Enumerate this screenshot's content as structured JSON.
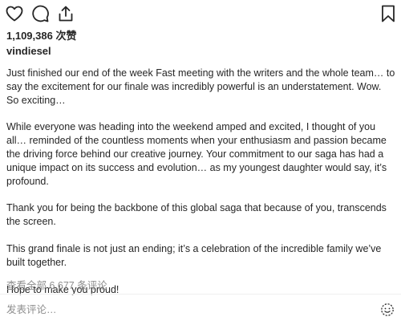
{
  "actions": {
    "like_icon": "heart-icon",
    "comment_icon": "comment-bubble-icon",
    "share_icon": "share-icon",
    "save_icon": "bookmark-icon"
  },
  "post": {
    "likes_text": "1,109,386 次赞",
    "username": "vindiesel",
    "caption": [
      "Just finished our end of the week Fast meeting with the writers and the whole team… to say the excitement for our finale was incredibly powerful is an understatement. Wow. So exciting…",
      "While everyone was heading into the weekend amped and excited, I thought of you all… reminded of the countless moments when your enthusiasm and passion became the driving force behind our creative journey. Your commitment to our saga has had a unique impact on its success and evolution… as my youngest daughter would say, it’s profound.",
      "Thank you for being the backbone of this global saga that because of you, transcends the screen.",
      "This grand finale is not just an ending; it’s a celebration of the incredible family we’ve built together.",
      "Hope to make you proud!"
    ],
    "view_all_comments": "查看全部 6,677 条评论"
  },
  "comment_box": {
    "placeholder": "发表评论…",
    "emoji_icon": "emoji-smile-icon"
  },
  "colors": {
    "text": "#262626",
    "muted": "#8e8e8e",
    "divider": "#efefef"
  }
}
